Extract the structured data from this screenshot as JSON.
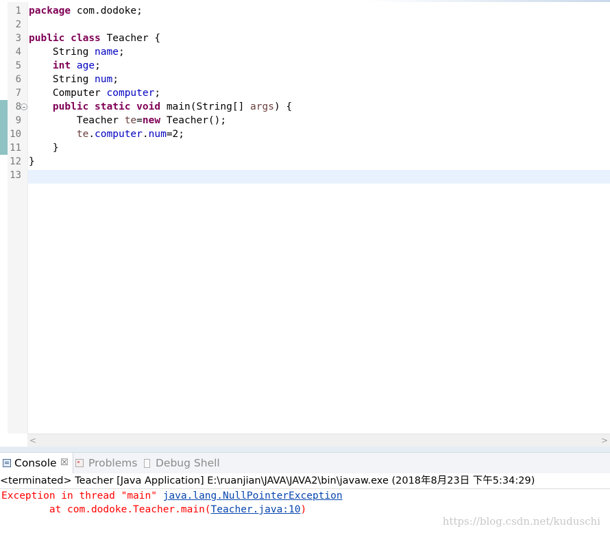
{
  "editor": {
    "line_numbers": [
      "1",
      "2",
      "3",
      "4",
      "5",
      "6",
      "7",
      "8",
      "9",
      "10",
      "11",
      "12",
      "13"
    ],
    "lines": [
      [
        {
          "t": "package",
          "c": "kw"
        },
        {
          "t": " com.dodoke;"
        }
      ],
      [],
      [
        {
          "t": "public",
          "c": "kw"
        },
        {
          "t": " "
        },
        {
          "t": "class",
          "c": "kw"
        },
        {
          "t": " Teacher {"
        }
      ],
      [
        {
          "t": "    String "
        },
        {
          "t": "name",
          "c": "fld"
        },
        {
          "t": ";"
        }
      ],
      [
        {
          "t": "    "
        },
        {
          "t": "int",
          "c": "kw"
        },
        {
          "t": " "
        },
        {
          "t": "age",
          "c": "fld"
        },
        {
          "t": ";"
        }
      ],
      [
        {
          "t": "    String "
        },
        {
          "t": "num",
          "c": "fld"
        },
        {
          "t": ";"
        }
      ],
      [
        {
          "t": "    Computer "
        },
        {
          "t": "computer",
          "c": "fld"
        },
        {
          "t": ";"
        }
      ],
      [
        {
          "t": "    "
        },
        {
          "t": "public",
          "c": "kw"
        },
        {
          "t": " "
        },
        {
          "t": "static",
          "c": "kw"
        },
        {
          "t": " "
        },
        {
          "t": "void",
          "c": "kw"
        },
        {
          "t": " main(String[] "
        },
        {
          "t": "args",
          "c": "var"
        },
        {
          "t": ") {"
        }
      ],
      [
        {
          "t": "        Teacher "
        },
        {
          "t": "te",
          "c": "var"
        },
        {
          "t": "="
        },
        {
          "t": "new",
          "c": "kw"
        },
        {
          "t": " Teacher();"
        }
      ],
      [
        {
          "t": "        "
        },
        {
          "t": "te",
          "c": "var"
        },
        {
          "t": "."
        },
        {
          "t": "computer",
          "c": "fld"
        },
        {
          "t": "."
        },
        {
          "t": "num",
          "c": "fld"
        },
        {
          "t": "=2;"
        }
      ],
      [
        {
          "t": "    }"
        }
      ],
      [
        {
          "t": "}"
        }
      ],
      []
    ],
    "current_line": 13,
    "changed_lines": [
      8,
      9,
      10,
      11
    ],
    "fold_line": 8
  },
  "scrollbar": {
    "left_arrow": "<",
    "right_arrow": ">"
  },
  "tabs": {
    "console": "Console",
    "console_close": "☒",
    "problems": "Problems",
    "debug_shell": "Debug Shell"
  },
  "console": {
    "header": "<terminated> Teacher [Java Application] E:\\ruanjian\\JAVA\\JAVA2\\bin\\javaw.exe (2018年8月23日 下午5:34:29)",
    "line1_prefix": "Exception in thread \"main\" ",
    "line1_link": "java.lang.NullPointerException",
    "line2_prefix": "        at com.dodoke.Teacher.main(",
    "line2_link": "Teacher.java:10",
    "line2_suffix": ")"
  },
  "watermark": "https://blog.csdn.net/kuduschi",
  "colors": {
    "keyword": "#7f0055",
    "field": "#0000c0",
    "local_variable": "#6a3e3e",
    "error_text": "#ff0000",
    "link": "#0645ad",
    "current_line_highlight": "#e8f2fe"
  }
}
